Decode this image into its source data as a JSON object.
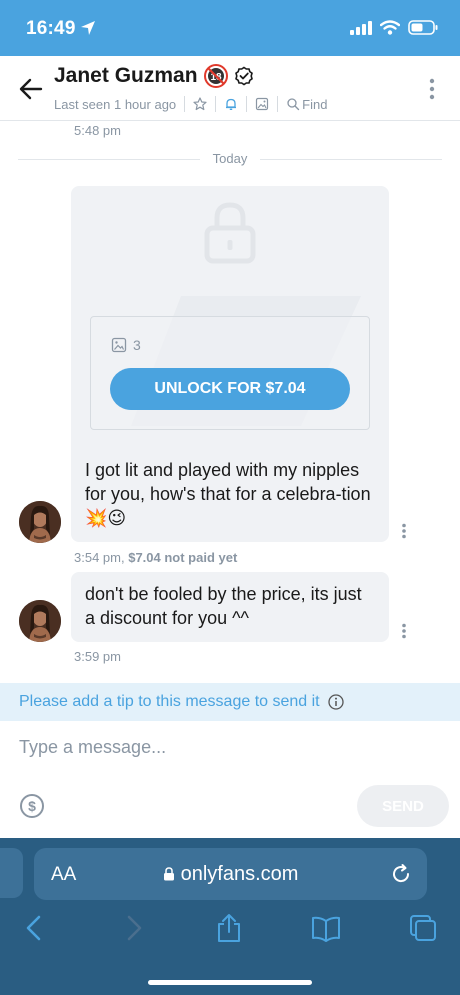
{
  "status_bar": {
    "time": "16:49"
  },
  "header": {
    "title": "Janet Guzman",
    "last_seen": "Last seen 1 hour ago",
    "find_label": "Find"
  },
  "chat": {
    "earlier_time": "5:48 pm",
    "divider_label": "Today",
    "locked_message": {
      "media_count": "3",
      "unlock_label": "UNLOCK FOR $7.04"
    },
    "messages": [
      {
        "text": "I got lit and played with my nipples for you, how's that for a celebra-tion 💥😉",
        "time": "3:54 pm,",
        "price_status": "$7.04 not paid yet"
      },
      {
        "text": "don't be fooled by the price, its just a discount for you ^^",
        "time": "3:59 pm"
      }
    ]
  },
  "tip_banner": {
    "text": "Please add a tip to this message to send it"
  },
  "composer": {
    "placeholder": "Type a message...",
    "send_label": "SEND"
  },
  "browser": {
    "text_size_label": "AA",
    "url": "onlyfans.com"
  },
  "colors": {
    "accent": "#4aa3df",
    "bubble": "#f0f2f5",
    "muted_text": "#8a96a3",
    "tip_banner_bg": "#e3f1fa",
    "browser_bar": "#2a5d82"
  }
}
